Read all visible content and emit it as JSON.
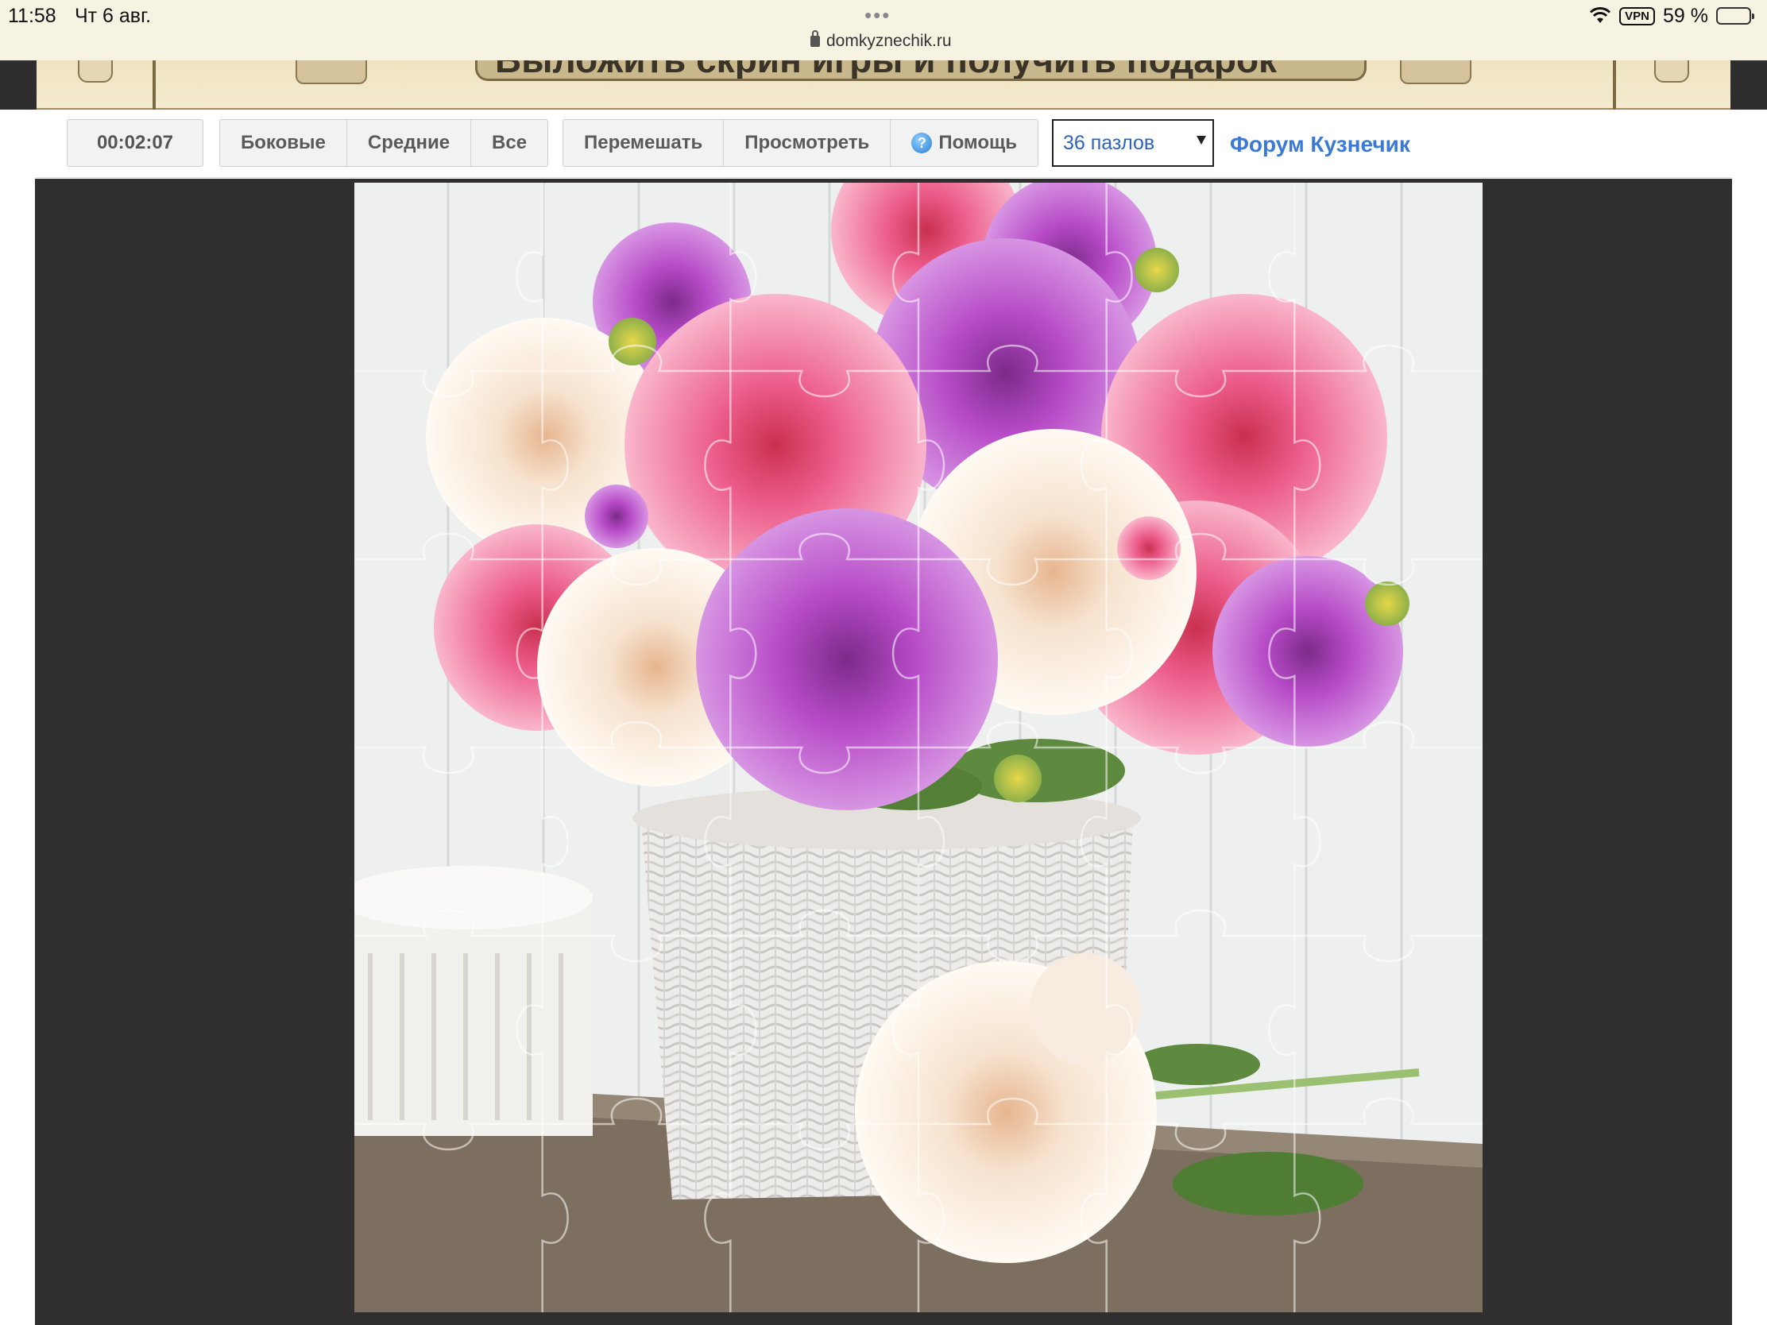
{
  "status_bar": {
    "time": "11:58",
    "date": "Чт 6 авг.",
    "url": "domkyznechik.ru",
    "vpn_label": "VPN",
    "battery": "59 %",
    "battery_level": 0.59
  },
  "banner": {
    "text": "Выложить скрин игры и получить подарок"
  },
  "toolbar": {
    "timer": "00:02:07",
    "filter_buttons": [
      "Боковые",
      "Средние",
      "Все"
    ],
    "action_buttons": {
      "shuffle": "Перемешать",
      "preview": "Просмотреть",
      "help": "Помощь"
    },
    "pieces_select": {
      "value": "36 пазлов"
    },
    "forum_link": "Форум Кузнечик"
  },
  "puzzle": {
    "grid": {
      "rows": 6,
      "cols": 6
    },
    "image_subject": "dahlias-in-white-wicker-basket",
    "colors": {
      "background_wall": "#eef0f0",
      "table": "#7c6f60",
      "pink": "#ec5c8a",
      "purple": "#b74bc7",
      "cream": "#f6e3cf",
      "leaf": "#5d8a3e"
    }
  }
}
